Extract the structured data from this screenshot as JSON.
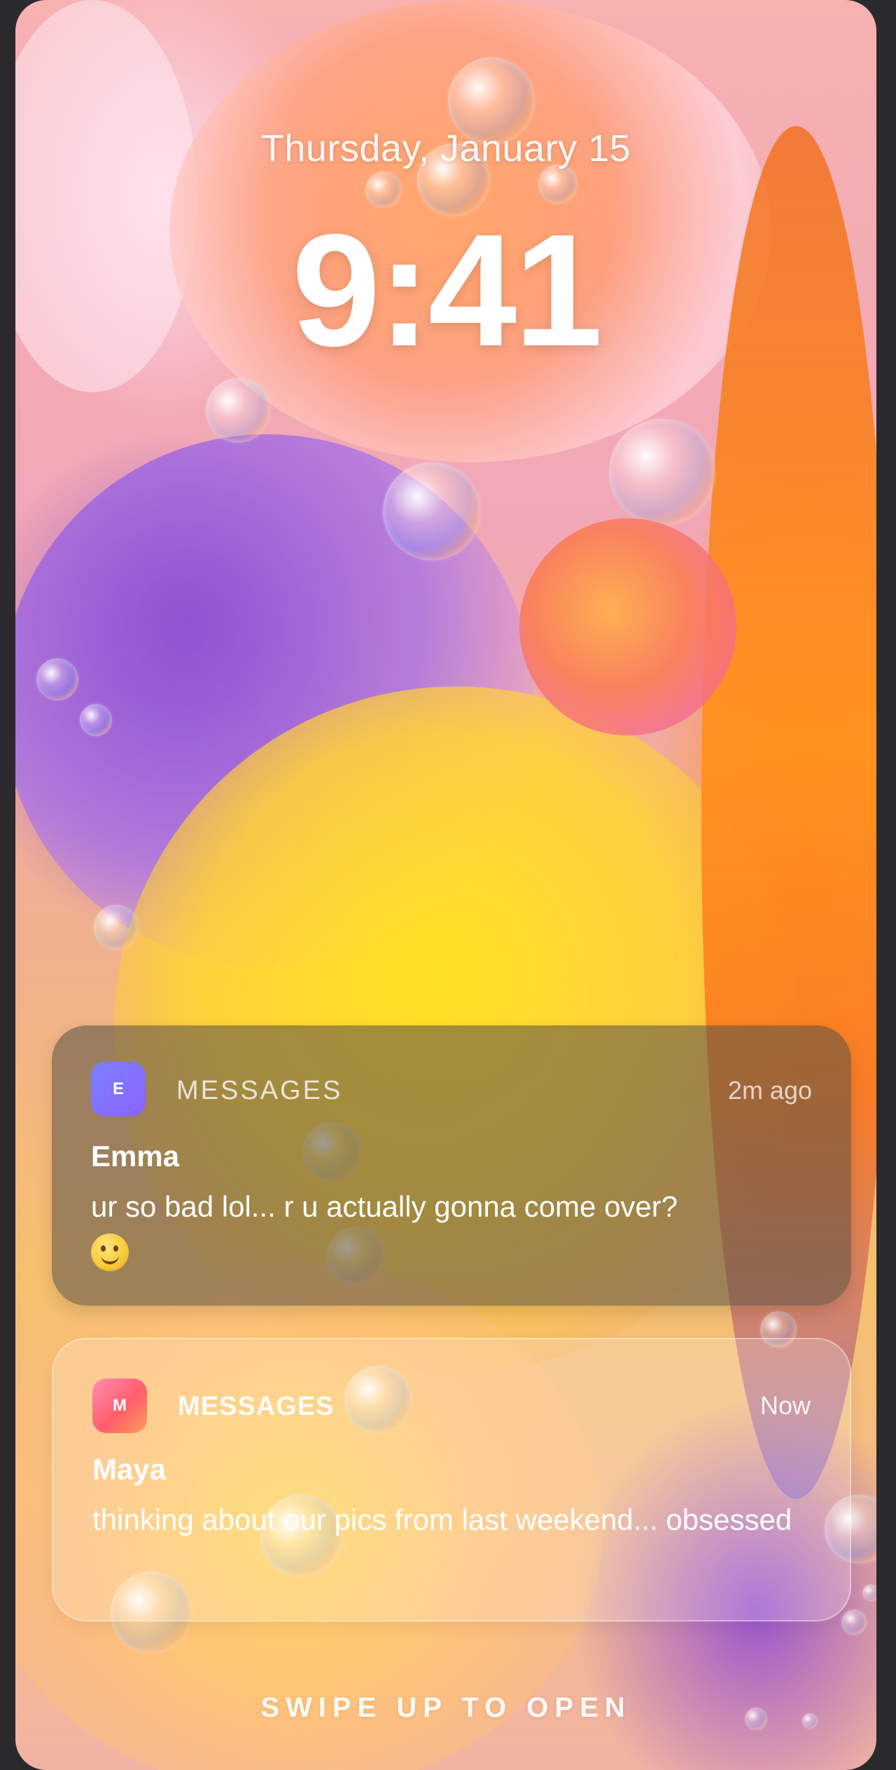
{
  "lock_screen": {
    "date": "Thursday, January 15",
    "time": "9:41",
    "swipe_hint": "SWIPE UP TO OPEN"
  },
  "notifications": [
    {
      "app_icon_letter": "E",
      "app_name": "MESSAGES",
      "timestamp": "2m ago",
      "sender": "Emma",
      "message": "ur so bad lol... r u actually gonna come over?",
      "emoji_name": "wink-face-emoji"
    },
    {
      "app_icon_letter": "M",
      "app_name": "MESSAGES",
      "timestamp": "Now",
      "sender": "Maya",
      "message": "thinking about our pics from last weekend... obsessed"
    }
  ],
  "colors": {
    "notification_dark_bg": "#5f5546",
    "notification_light_bg": "#ffffff",
    "text_primary": "#ffffff",
    "emma_icon": "#7a80ff",
    "maya_icon": "#ff5d6d"
  }
}
